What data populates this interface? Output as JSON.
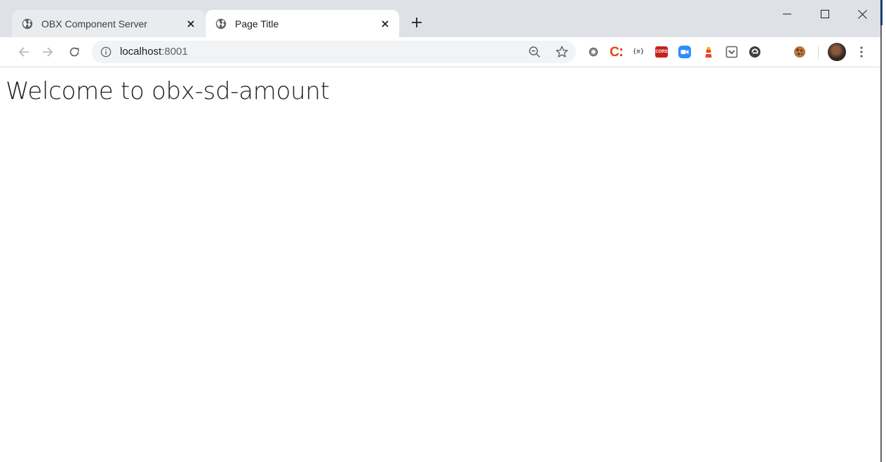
{
  "browser": {
    "tabs": [
      {
        "title": "OBX Component Server",
        "active": false,
        "icon": "globe-icon"
      },
      {
        "title": "Page Title",
        "active": true,
        "icon": "globe-icon"
      }
    ],
    "omnibox": {
      "host": "localhost",
      "port": ":8001"
    },
    "extensions": [
      "circle-extension-icon",
      "c-extension-icon",
      "json-extension-icon",
      "cors-extension-icon",
      "zoom-extension-icon",
      "lighthouse-extension-icon",
      "pocket-extension-icon",
      "edit-extension-icon",
      "cookie-extension-icon"
    ],
    "extension_labels": {
      "c": "C",
      "json": "{≡}",
      "cors": "CORS"
    },
    "colors": {
      "tabstrip": "#dee1e6",
      "cors_red": "#c5221f",
      "zoom_blue": "#2d8cff"
    }
  },
  "page": {
    "heading": "Welcome to obx-sd-amount"
  }
}
